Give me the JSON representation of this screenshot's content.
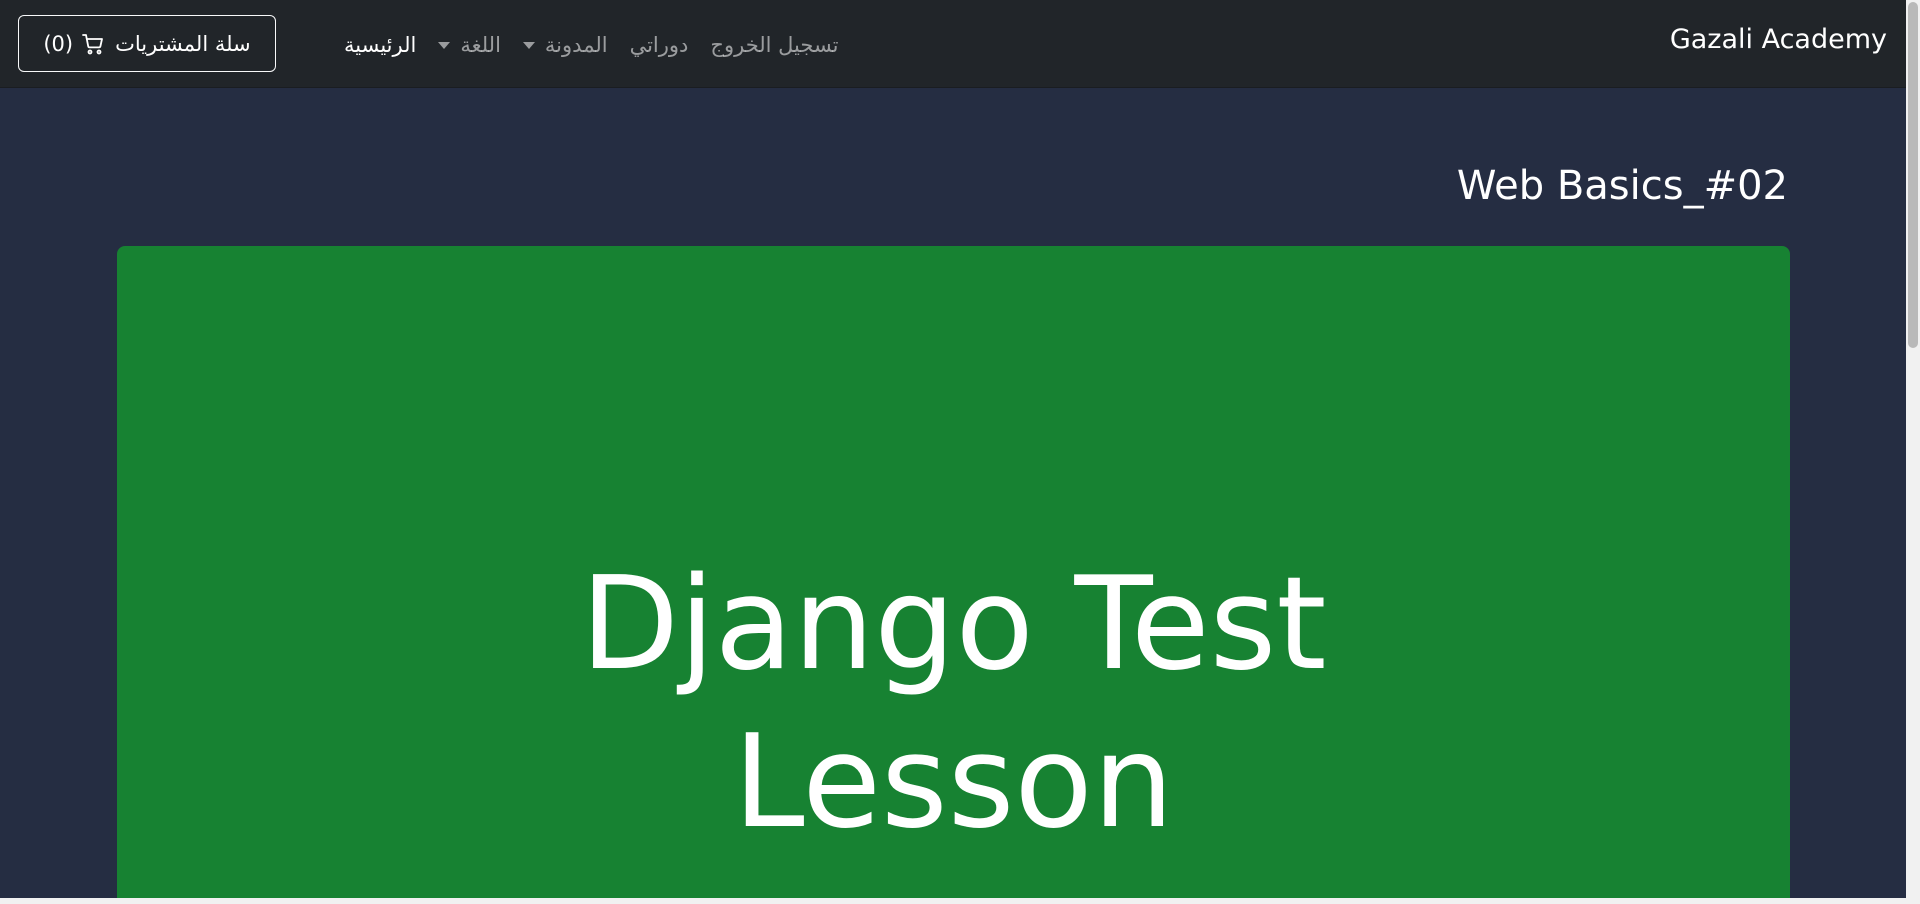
{
  "navbar": {
    "brand": "Gazali Academy",
    "items": [
      {
        "label": "الرئيسية",
        "active": true,
        "dropdown": false
      },
      {
        "label": "اللغة",
        "active": false,
        "dropdown": true
      },
      {
        "label": "المدونة",
        "active": false,
        "dropdown": true
      },
      {
        "label": "دوراتي",
        "active": false,
        "dropdown": false
      },
      {
        "label": "تسجيل الخروج",
        "active": false,
        "dropdown": false
      }
    ],
    "cart": {
      "label": "سلة المشتريات",
      "count": "(0)",
      "icon": "cart-icon"
    }
  },
  "page": {
    "title": "Web Basics_#02"
  },
  "video": {
    "title_line1": "Django Test",
    "title_line2": "Lesson",
    "background": "#178232"
  },
  "colors": {
    "navbar_bg": "#212529",
    "page_bg": "#252d42"
  }
}
